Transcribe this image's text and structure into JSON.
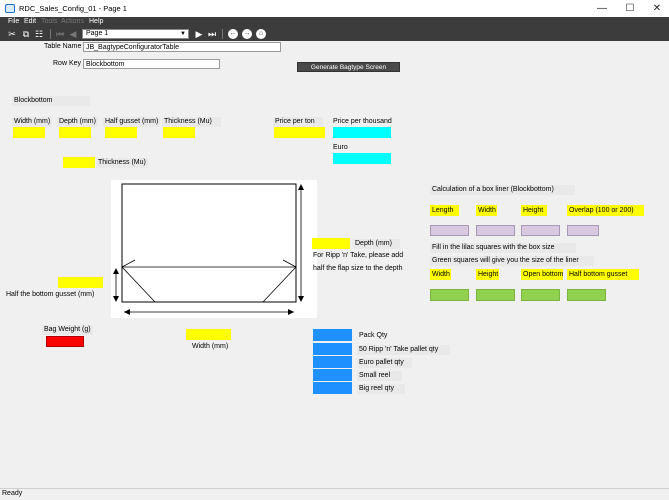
{
  "window": {
    "title": "RDC_Sales_Config_01 - Page 1",
    "minimize_glyph": "—",
    "maximize_glyph": "☐",
    "close_glyph": "✕"
  },
  "menu": [
    {
      "label": "File",
      "enabled": true
    },
    {
      "label": "Edit",
      "enabled": true
    },
    {
      "label": "Tools",
      "enabled": false
    },
    {
      "label": "Actions",
      "enabled": false
    },
    {
      "label": "Help",
      "enabled": true
    }
  ],
  "toolbar": {
    "icons": [
      "scissors-icon",
      "copy-icon",
      "paste-icon",
      "first-page-icon",
      "previous-page-icon",
      "play-icon",
      "last-page-icon",
      "back-icon",
      "forward-icon",
      "home-icon"
    ],
    "page_select_value": "Page 1"
  },
  "form": {
    "table_name_label": "Table Name",
    "table_name_value": "JB_BagtypeConfiguratorTable",
    "row_key_label": "Row Key",
    "row_key_value": "Blockbottom",
    "generate_button": "Generate Bagtype Screen",
    "section_title": "Blockbottom"
  },
  "dimensions": {
    "width_label": "Width (mm)",
    "depth_label": "Depth (mm)",
    "half_gusset_label": "Half gusset (mm)",
    "thickness_label": "Thickness (Mu)",
    "price_per_ton_label": "Price per ton",
    "price_per_thousand_label": "Price per thousand",
    "euro_label": "Euro",
    "thickness2_label": "Thickness (Mu)"
  },
  "diagram": {
    "depth_label": "Depth (mm)",
    "ripp_note_1": "For Ripp 'n' Take, please add",
    "ripp_note_2": "half the flap size to the depth",
    "half_bottom_gusset_label": "Half the bottom gusset (mm)",
    "bag_weight_label": "Bag Weight (g)",
    "width_label": "Width (mm)"
  },
  "liner": {
    "title": "Calculation of a box liner (Blockbottom)",
    "box_headers": [
      "Length",
      "Width",
      "Height",
      "Overlap (100 or 200)"
    ],
    "instruction_1": "Fill in the lilac squares with the box size",
    "instruction_2": "Green squares will give you the size of the liner",
    "result_headers": [
      "Width",
      "Height",
      "Open bottom",
      "Half bottom gusset"
    ]
  },
  "packing": {
    "rows": [
      "Pack Qty",
      "50 Ripp 'n' Take pallet qty",
      "Euro pallet qty",
      "Small reel",
      "Big reel qty"
    ]
  },
  "colors": {
    "yellow": "#ffff00",
    "cyan": "#00ffff",
    "lilac": "#d8c8e0",
    "green": "#92d050",
    "blue": "#1e90ff",
    "red": "#ff0000"
  },
  "status": {
    "text": "Ready"
  }
}
